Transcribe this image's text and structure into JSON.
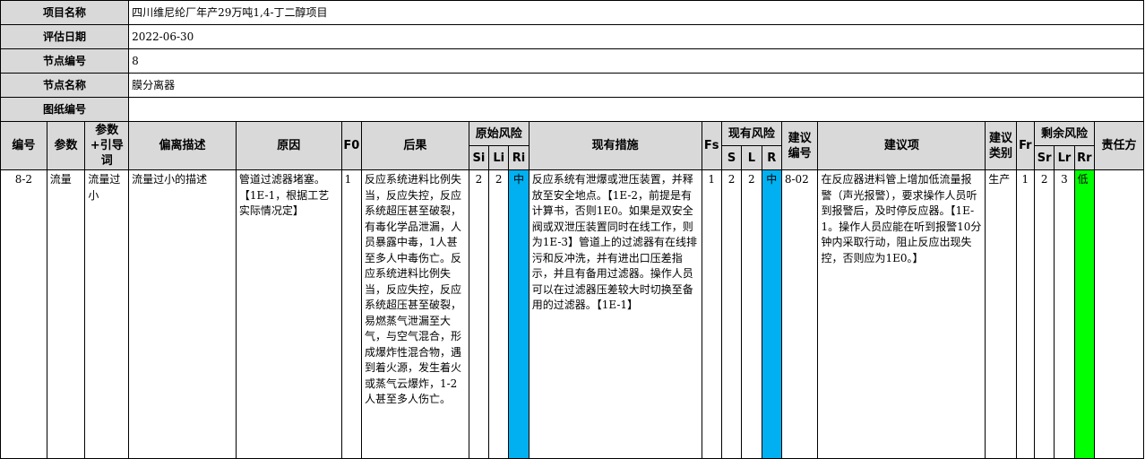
{
  "info": {
    "project_name_label": "项目名称",
    "project_name_value": "四川维尼纶厂年产29万吨1,4-丁二醇项目",
    "date_label": "评估日期",
    "date_value": "2022-06-30",
    "node_no_label": "节点编号",
    "node_no_value": "8",
    "node_name_label": "节点名称",
    "node_name_value": "膜分离器",
    "drawing_label": "图纸编号",
    "drawing_value": ""
  },
  "headers": {
    "no": "编号",
    "param": "参数",
    "guide": "参数+引导词",
    "deviation": "偏离描述",
    "cause": "原因",
    "f0": "F0",
    "consequence": "后果",
    "orig_risk": "原始风险",
    "si": "Si",
    "li": "Li",
    "ri": "Ri",
    "measures": "现有措施",
    "fs": "Fs",
    "cur_risk": "现有风险",
    "s": "S",
    "l": "L",
    "r": "R",
    "rec_no": "建议编号",
    "rec": "建议项",
    "rec_type": "建议类别",
    "fr": "Fr",
    "res_risk": "剩余风险",
    "sr": "Sr",
    "lr": "Lr",
    "rr": "Rr",
    "owner": "责任方"
  },
  "row": {
    "no": "8-2",
    "param": "流量",
    "guide": "流量过小",
    "deviation": "流量过小的描述",
    "cause": "管道过滤器堵塞。【1E-1，根据工艺实际情况定】",
    "f0": "1",
    "consequence": "反应系统进料比例失当，反应失控，反应系统超压甚至破裂，有毒化学品泄漏，人员暴露中毒，1人甚至多人中毒伤亡。反应系统进料比例失当，反应失控，反应系统超压甚至破裂，易燃蒸气泄漏至大气，与空气混合，形成爆炸性混合物，遇到着火源，发生着火或蒸气云爆炸，1-2人甚至多人伤亡。",
    "si": "2",
    "li": "2",
    "ri": "中",
    "measures": "反应系统有泄爆或泄压装置，并释放至安全地点。【1E-2，前提是有计算书，否则1E0。如果是双安全阀或双泄压装置同时在线工作，则为1E-3】管道上的过滤器有在线排污和反冲洗，并有进出口压差指示，并且有备用过滤器。操作人员可以在过滤器压差较大时切换至备用的过滤器。【1E-1】",
    "fs": "1",
    "s": "2",
    "l": "2",
    "r": "中",
    "rec_no": "8-02",
    "rec": "在反应器进料管上增加低流量报警（声光报警），要求操作人员听到报警后，及时停反应器。【1E-1。操作人员应能在听到报警10分钟内采取行动，阻止反应出现失控，否则应为1E0。】",
    "rec_type": "生产",
    "fr": "1",
    "sr": "2",
    "lr": "3",
    "rr": "低",
    "owner": ""
  },
  "colors": {
    "ri": "#00b0f0",
    "r": "#00b0f0",
    "rr": "#00ff00",
    "header_bg": "#d9d9d9"
  }
}
